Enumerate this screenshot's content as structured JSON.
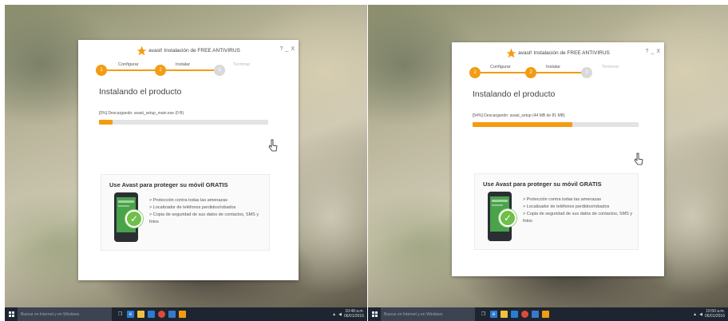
{
  "screenshots": [
    {
      "window": {
        "brand": "avast!",
        "title": "Instalación de FREE ANTIVIRUS",
        "controls": [
          "?",
          "_",
          "X"
        ]
      },
      "steps": [
        {
          "number": "1",
          "label": "Configurar",
          "state": "done"
        },
        {
          "number": "2",
          "label": "Instalar",
          "state": "active"
        },
        {
          "number": "3",
          "label": "Terminar",
          "state": "pending"
        }
      ],
      "heading": "Instalando el producto",
      "progress": {
        "text": "[0%] Descargando: avast_setup_main.exe (0 B)",
        "fraction": 0.08
      },
      "promo": {
        "title": "Use Avast para proteger su móvil GRATIS",
        "features": [
          "> Protección contra todas las amenazas",
          "> Localizador de teléfonos perdidos/robados",
          "> Copia de seguridad de sus datos de contactos, SMS y fotos"
        ]
      },
      "taskbar": {
        "search_placeholder": "Buscar en Internet y en Windows",
        "time": "10:48 a.m.",
        "date": "06/01/2016"
      }
    },
    {
      "window": {
        "brand": "avast!",
        "title": "Instalación de FREE ANTIVIRUS",
        "controls": [
          "?",
          "_",
          "X"
        ]
      },
      "steps": [
        {
          "number": "1",
          "label": "Configurar",
          "state": "done"
        },
        {
          "number": "2",
          "label": "Instalar",
          "state": "active"
        },
        {
          "number": "3",
          "label": "Terminar",
          "state": "pending"
        }
      ],
      "heading": "Instalando el producto",
      "progress": {
        "text": "[54%] Descargando: avast_setup (44 MB de 81 MB)",
        "fraction": 0.6
      },
      "promo": {
        "title": "Use Avast para proteger su móvil GRATIS",
        "features": [
          "> Protección contra todas las amenazas",
          "> Localizador de teléfonos perdidos/robados",
          "> Copia de seguridad de sus datos de contactos, SMS y fotos"
        ]
      },
      "taskbar": {
        "search_placeholder": "Buscar en Internet y en Windows",
        "time": "10:50 a.m.",
        "date": "06/01/2016"
      }
    }
  ],
  "colors": {
    "accent": "#f39c12",
    "inactive": "#d9d9d9",
    "taskbar": "#1d2530",
    "check": "#6fbf4a"
  }
}
